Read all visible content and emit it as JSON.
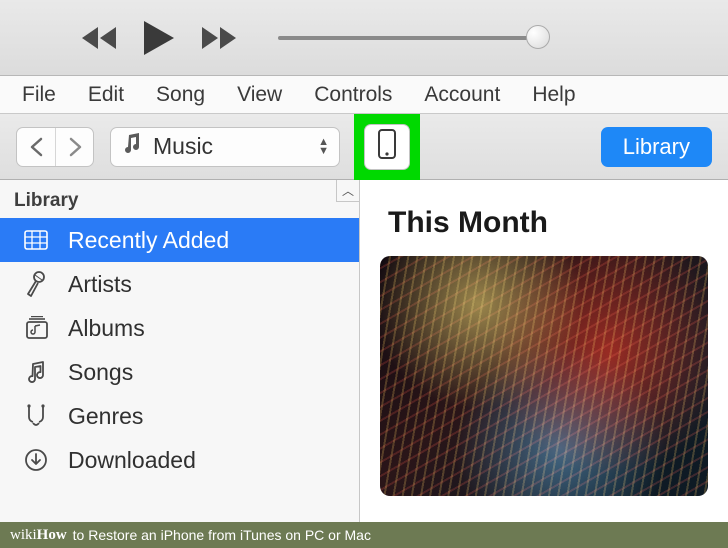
{
  "playback": {
    "progress_pct": 100
  },
  "menubar": [
    "File",
    "Edit",
    "Song",
    "View",
    "Controls",
    "Account",
    "Help"
  ],
  "toolbar": {
    "category_label": "Music",
    "library_button": "Library"
  },
  "sidebar": {
    "header": "Library",
    "items": [
      {
        "label": "Recently Added",
        "icon": "grid-icon",
        "selected": true
      },
      {
        "label": "Artists",
        "icon": "mic-icon",
        "selected": false
      },
      {
        "label": "Albums",
        "icon": "albums-icon",
        "selected": false
      },
      {
        "label": "Songs",
        "icon": "note-icon",
        "selected": false
      },
      {
        "label": "Genres",
        "icon": "guitar-icon",
        "selected": false
      },
      {
        "label": "Downloaded",
        "icon": "download-icon",
        "selected": false
      }
    ]
  },
  "main": {
    "heading": "This Month"
  },
  "caption": {
    "brand_a": "wiki",
    "brand_b": "How",
    "text": " to Restore an iPhone from iTunes on PC or Mac"
  }
}
